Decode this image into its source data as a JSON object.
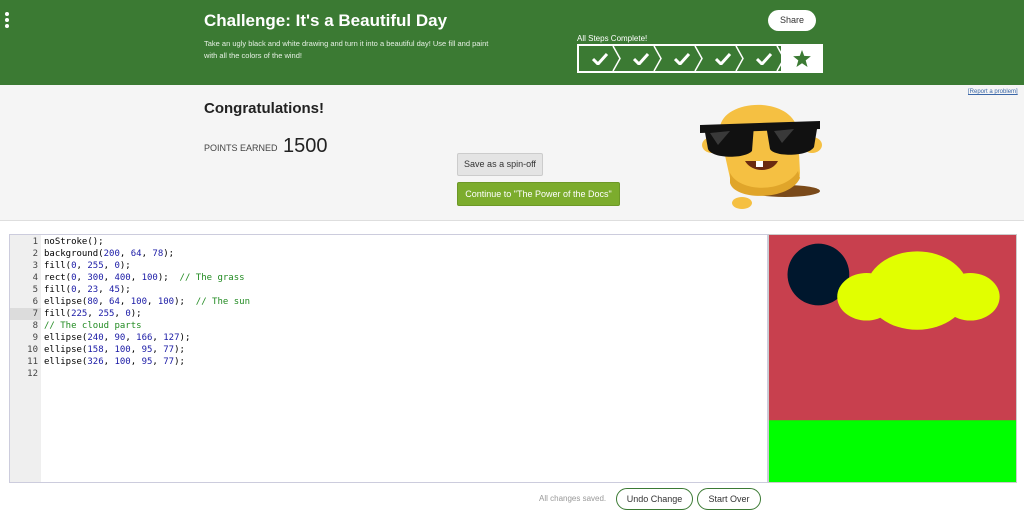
{
  "header": {
    "title": "Challenge: It's a Beautiful Day",
    "description": "Take an ugly black and white drawing and turn it into a beautiful day! Use fill and paint with all the colors of the wind!",
    "share_label": "Share",
    "steps_label": "All Steps Complete!",
    "steps": [
      "check-icon",
      "check-icon",
      "check-icon",
      "check-icon",
      "check-icon",
      "star-icon"
    ],
    "bg_color": "#3b7a33"
  },
  "congrats": {
    "report_link": "[Report a problem]",
    "title": "Congratulations!",
    "points_label": "POINTS EARNED",
    "points_value": "1500",
    "spinoff_label": "Save as a spin-off",
    "continue_label": "Continue to \"The Power of the Docs\""
  },
  "editor": {
    "line_numbers": [
      "1",
      "2",
      "3",
      "4",
      "5",
      "6",
      "7",
      "8",
      "9",
      "10",
      "11",
      "12"
    ],
    "active_line": 7,
    "lines": [
      "noStroke();",
      "background(200, 64, 78);",
      "fill(0, 255, 0);",
      "rect(0, 300, 400, 100);  // The grass",
      "fill(0, 23, 45);",
      "ellipse(80, 64, 100, 100);  // The sun",
      "fill(225, 255, 0);",
      "// The cloud parts",
      "ellipse(240, 90, 166, 127);",
      "ellipse(158, 100, 95, 77);",
      "ellipse(326, 100, 95, 77);",
      ""
    ]
  },
  "canvas": {
    "background": "#c8404e",
    "grass": "#00ff00",
    "sun": "#00172d",
    "cloud": "#e1ff00"
  },
  "footer": {
    "saved_text": "All changes saved.",
    "undo_label": "Undo Change",
    "start_over_label": "Start Over"
  }
}
